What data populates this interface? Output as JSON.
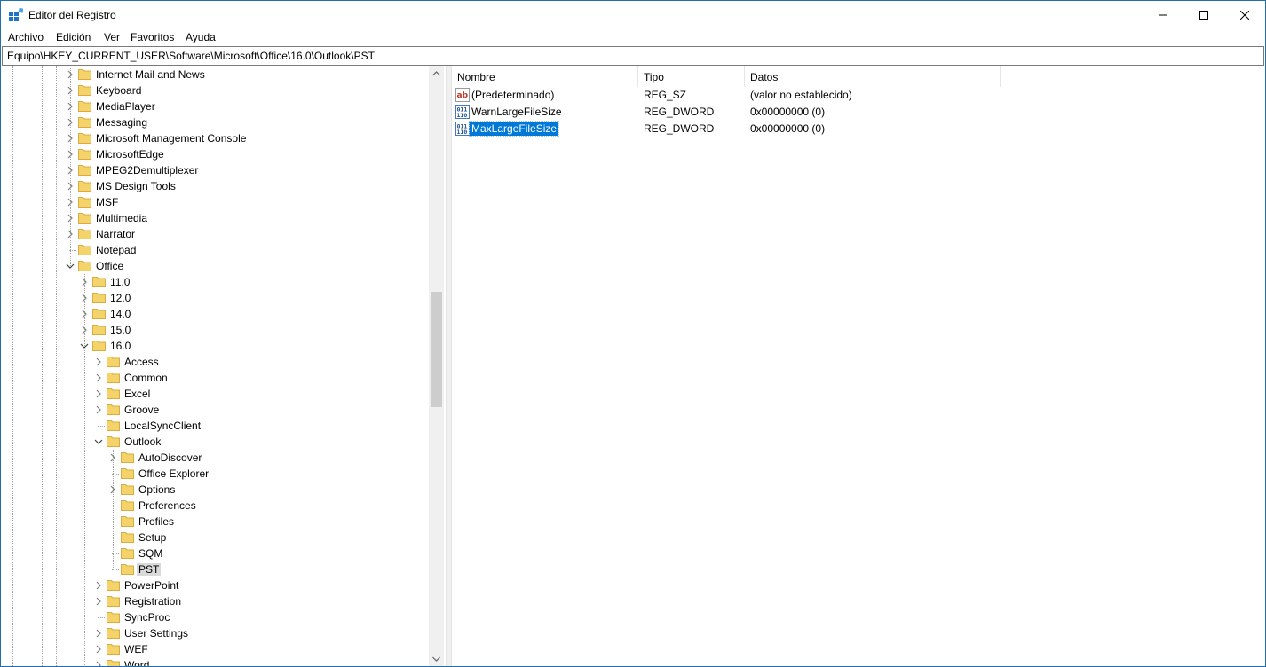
{
  "window": {
    "title": "Editor del Registro"
  },
  "menu": [
    "Archivo",
    "Edición",
    "Ver",
    "Favoritos",
    "Ayuda"
  ],
  "address": "Equipo\\HKEY_CURRENT_USER\\Software\\Microsoft\\Office\\16.0\\Outlook\\PST",
  "tree": {
    "items": [
      {
        "label": "Internet Mail and News",
        "level": 0,
        "expander": "collapsed"
      },
      {
        "label": "Keyboard",
        "level": 0,
        "expander": "collapsed"
      },
      {
        "label": "MediaPlayer",
        "level": 0,
        "expander": "collapsed"
      },
      {
        "label": "Messaging",
        "level": 0,
        "expander": "collapsed"
      },
      {
        "label": "Microsoft Management Console",
        "level": 0,
        "expander": "collapsed"
      },
      {
        "label": "MicrosoftEdge",
        "level": 0,
        "expander": "collapsed"
      },
      {
        "label": "MPEG2Demultiplexer",
        "level": 0,
        "expander": "collapsed"
      },
      {
        "label": "MS Design Tools",
        "level": 0,
        "expander": "collapsed"
      },
      {
        "label": "MSF",
        "level": 0,
        "expander": "collapsed"
      },
      {
        "label": "Multimedia",
        "level": 0,
        "expander": "collapsed"
      },
      {
        "label": "Narrator",
        "level": 0,
        "expander": "collapsed"
      },
      {
        "label": "Notepad",
        "level": 0,
        "expander": "none"
      },
      {
        "label": "Office",
        "level": 0,
        "expander": "expanded"
      },
      {
        "label": "11.0",
        "level": 1,
        "expander": "collapsed"
      },
      {
        "label": "12.0",
        "level": 1,
        "expander": "collapsed"
      },
      {
        "label": "14.0",
        "level": 1,
        "expander": "collapsed"
      },
      {
        "label": "15.0",
        "level": 1,
        "expander": "collapsed"
      },
      {
        "label": "16.0",
        "level": 1,
        "expander": "expanded"
      },
      {
        "label": "Access",
        "level": 2,
        "expander": "collapsed"
      },
      {
        "label": "Common",
        "level": 2,
        "expander": "collapsed"
      },
      {
        "label": "Excel",
        "level": 2,
        "expander": "collapsed"
      },
      {
        "label": "Groove",
        "level": 2,
        "expander": "collapsed"
      },
      {
        "label": "LocalSyncClient",
        "level": 2,
        "expander": "none"
      },
      {
        "label": "Outlook",
        "level": 2,
        "expander": "expanded"
      },
      {
        "label": "AutoDiscover",
        "level": 3,
        "expander": "collapsed"
      },
      {
        "label": "Office Explorer",
        "level": 3,
        "expander": "none"
      },
      {
        "label": "Options",
        "level": 3,
        "expander": "collapsed"
      },
      {
        "label": "Preferences",
        "level": 3,
        "expander": "none"
      },
      {
        "label": "Profiles",
        "level": 3,
        "expander": "none"
      },
      {
        "label": "Setup",
        "level": 3,
        "expander": "none"
      },
      {
        "label": "SQM",
        "level": 3,
        "expander": "none"
      },
      {
        "label": "PST",
        "level": 3,
        "expander": "none",
        "selected": true
      },
      {
        "label": "PowerPoint",
        "level": 2,
        "expander": "collapsed"
      },
      {
        "label": "Registration",
        "level": 2,
        "expander": "collapsed"
      },
      {
        "label": "SyncProc",
        "level": 2,
        "expander": "none"
      },
      {
        "label": "User Settings",
        "level": 2,
        "expander": "collapsed"
      },
      {
        "label": "WEF",
        "level": 2,
        "expander": "collapsed"
      },
      {
        "label": "Word",
        "level": 2,
        "expander": "collapsed"
      }
    ]
  },
  "values": {
    "columns": {
      "name": "Nombre",
      "type": "Tipo",
      "data": "Datos"
    },
    "rows": [
      {
        "name": "(Predeterminado)",
        "type": "REG_SZ",
        "data": "(valor no establecido)",
        "icon": "string-value-icon"
      },
      {
        "name": "WarnLargeFileSize",
        "type": "REG_DWORD",
        "data": "0x00000000 (0)",
        "icon": "binary-value-icon"
      },
      {
        "name": "MaxLargeFileSize",
        "type": "REG_DWORD",
        "data": "0x00000000 (0)",
        "icon": "binary-value-icon",
        "selected": true
      }
    ]
  },
  "colors": {
    "selection": "#0078d7",
    "folder": "#f5d36b",
    "tree_selection": "#d9d9d9"
  }
}
